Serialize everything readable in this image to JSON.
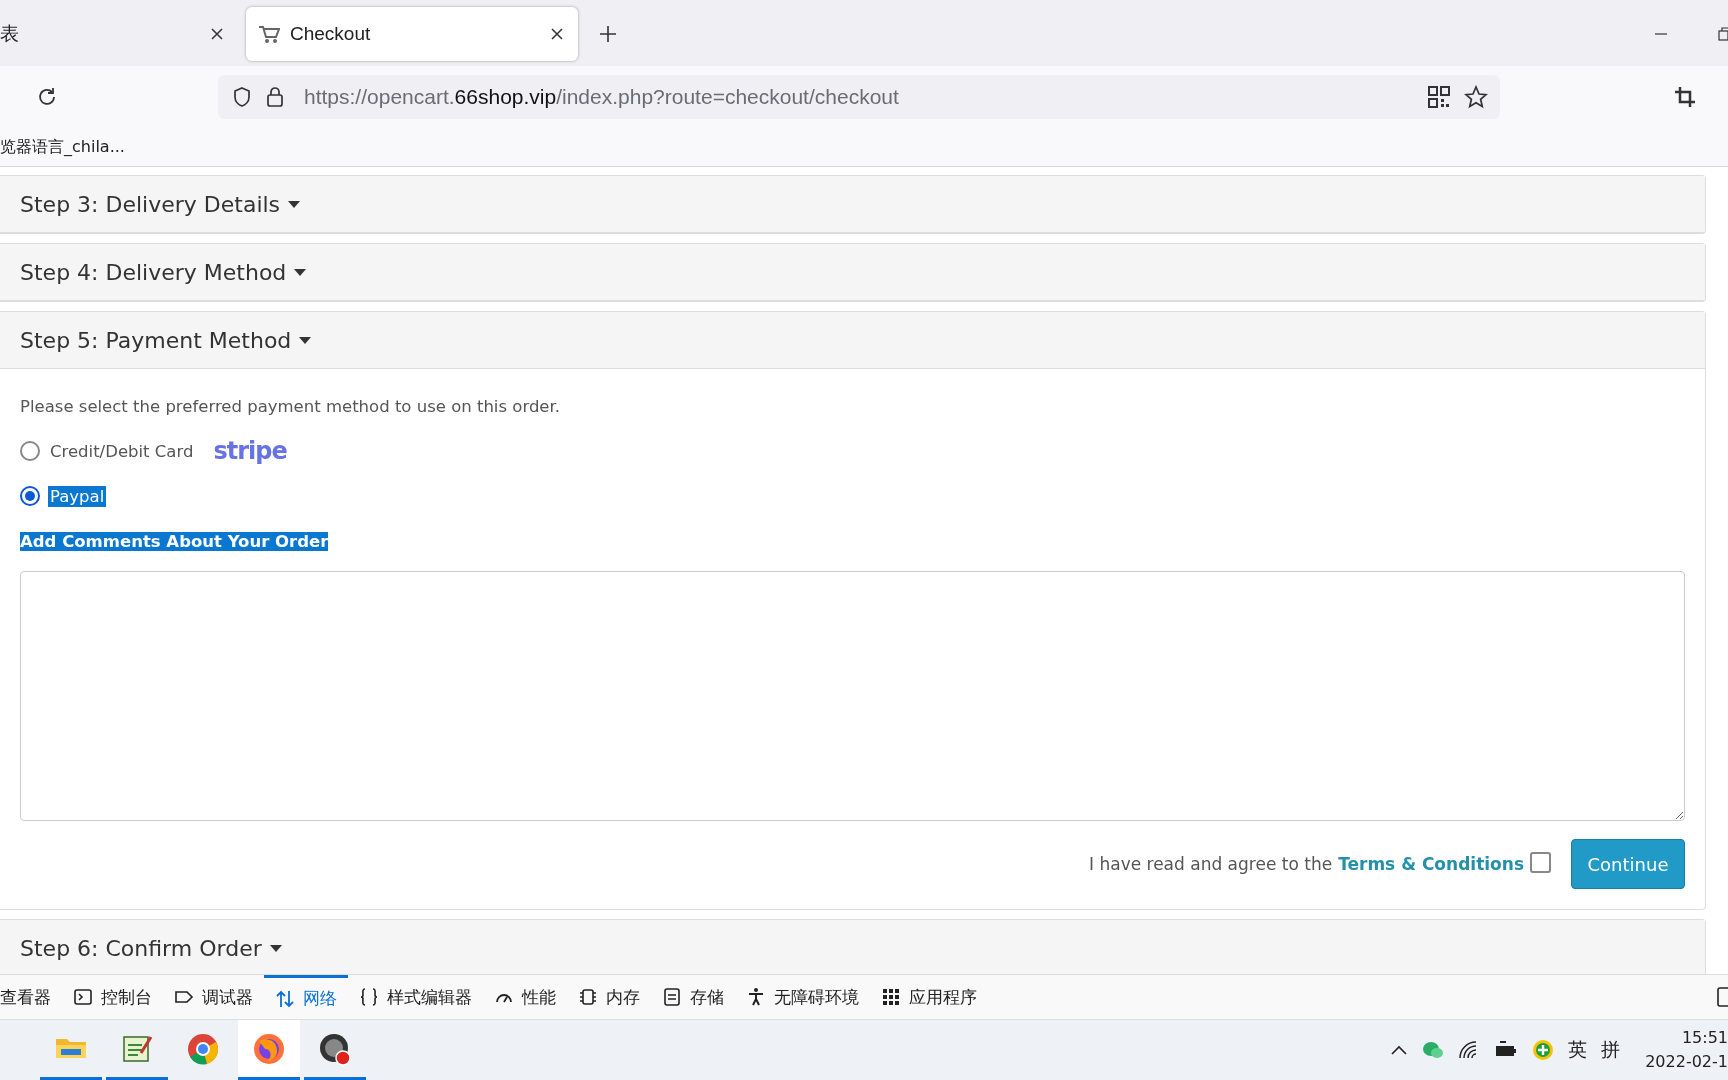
{
  "browser": {
    "tabs": [
      {
        "title": "表",
        "selected": false,
        "icon": false
      },
      {
        "title": "Checkout",
        "selected": true,
        "icon": true
      }
    ],
    "url": {
      "prefix": "https://opencart.",
      "host": "66shop.vip",
      "path": "/index.php?route=checkout/checkout"
    },
    "bookmarks": [
      "览器语言_chila..."
    ]
  },
  "steps": [
    {
      "title": "Step 3: Delivery Details",
      "expanded": false
    },
    {
      "title": "Step 4: Delivery Method",
      "expanded": false
    },
    {
      "title": "Step 5: Payment Method",
      "expanded": true
    },
    {
      "title": "Step 6: Confirm Order",
      "expanded": false
    }
  ],
  "payment": {
    "instruction": "Please select the preferred payment method to use on this order.",
    "methods": [
      {
        "label": "Credit/Debit Card",
        "selected": false,
        "highlighted": false,
        "brand": "stripe"
      },
      {
        "label": "Paypal",
        "selected": true,
        "highlighted": true
      }
    ],
    "comments_heading": {
      "text": "Add Comments About Your Order",
      "highlighted": true
    },
    "agree_text": "I have read and agree to the",
    "terms_link": "Terms & Conditions",
    "agreed": false,
    "button": "Continue"
  },
  "devtools": {
    "tabs": [
      {
        "label": "查看器",
        "selected": false,
        "kind": "inspector"
      },
      {
        "label": "控制台",
        "selected": false,
        "kind": "console"
      },
      {
        "label": "调试器",
        "selected": false,
        "kind": "debugger"
      },
      {
        "label": "网络",
        "selected": true,
        "kind": "network"
      },
      {
        "label": "样式编辑器",
        "selected": false,
        "kind": "style"
      },
      {
        "label": "性能",
        "selected": false,
        "kind": "performance"
      },
      {
        "label": "内存",
        "selected": false,
        "kind": "memory"
      },
      {
        "label": "存储",
        "selected": false,
        "kind": "storage"
      },
      {
        "label": "无障碍环境",
        "selected": false,
        "kind": "accessibility"
      },
      {
        "label": "应用程序",
        "selected": false,
        "kind": "application"
      }
    ]
  },
  "taskbar": {
    "apps": [
      {
        "kind": "files",
        "running": true,
        "selected": false
      },
      {
        "kind": "notepad",
        "running": true,
        "selected": false
      },
      {
        "kind": "chrome",
        "running": false,
        "selected": false
      },
      {
        "kind": "firefox",
        "running": true,
        "selected": true
      },
      {
        "kind": "recorder",
        "running": true,
        "selected": false
      }
    ],
    "input_language": "英",
    "input_mode": "拼",
    "time": "15:51",
    "date": "2022-02-1"
  }
}
